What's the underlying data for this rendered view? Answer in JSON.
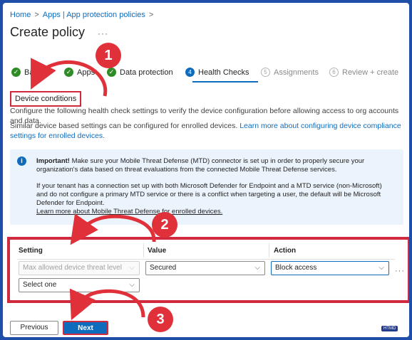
{
  "breadcrumb": [
    "Home",
    "Apps | App protection policies"
  ],
  "page": {
    "title": "Create policy",
    "more": "···"
  },
  "steps": [
    {
      "label": "Basics",
      "state": "done"
    },
    {
      "label": "Apps",
      "state": "done"
    },
    {
      "label": "Data protection",
      "state": "done"
    },
    {
      "label": "Health Checks",
      "num": "4",
      "state": "active"
    },
    {
      "label": "Assignments",
      "num": "5",
      "state": "inactive"
    },
    {
      "label": "Review + create",
      "num": "6",
      "state": "inactive"
    }
  ],
  "section": {
    "label": "Device conditions",
    "desc": "Configure the following health check settings to verify the device configuration before allowing access to org accounts and data.",
    "similar_text": "Similar device based settings can be configured for enrolled devices.",
    "similar_link": "Learn more about configuring device compliance settings for enrolled devices."
  },
  "info": {
    "important_label": "Important!",
    "important_text": "Make sure your Mobile Threat Defense (MTD) connector is set up in order to properly secure your organization's data based on threat evaluations from the connected Mobile Threat Defense services.",
    "tenant_text": "If your tenant has a connection set up with both Microsoft Defender for Endpoint and a MTD service (non-Microsoft) and do not configure a primary MTD service or there is a conflict when targeting a user, the default will be Microsoft Defender for Endpoint.",
    "link": "Learn more about Mobile Threat Defense for enrolled devices."
  },
  "table": {
    "headers": [
      "Setting",
      "Value",
      "Action"
    ],
    "row": {
      "setting": "Max allowed device threat level",
      "value": "Secured",
      "action": "Block access"
    },
    "new_row_placeholder": "Select one",
    "row_menu": "···"
  },
  "buttons": {
    "previous": "Previous",
    "next": "Next"
  },
  "badges": [
    "1",
    "2",
    "3"
  ],
  "watermark": "HTMD",
  "colors": {
    "accent": "#0f6cbd",
    "annotation_red": "#d1293d",
    "done_green": "#2e8b26",
    "frame_blue": "#1e4ea8"
  },
  "icons": {
    "done": "check-icon",
    "chevron": "chevron-down-icon",
    "info": "info-icon"
  }
}
